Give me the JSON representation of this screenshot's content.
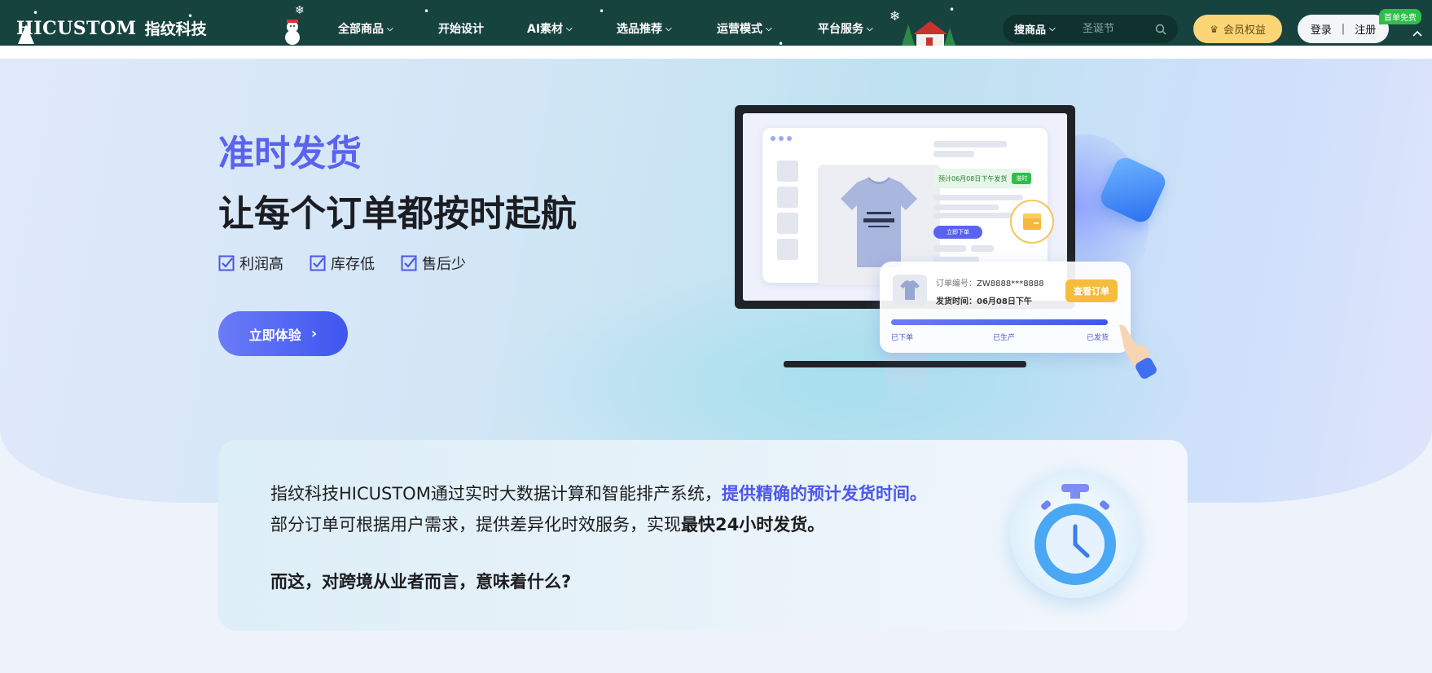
{
  "nav": {
    "logo_en": "HICUSTOM",
    "logo_cn": "指纹科技",
    "menus": [
      {
        "label": "全部商品",
        "has_dropdown": true
      },
      {
        "label": "开始设计",
        "has_dropdown": false
      },
      {
        "label": "AI素材",
        "has_dropdown": true
      },
      {
        "label": "选品推荐",
        "has_dropdown": true
      },
      {
        "label": "运营模式",
        "has_dropdown": true
      },
      {
        "label": "平台服务",
        "has_dropdown": true
      }
    ],
    "search": {
      "category_label": "搜商品",
      "placeholder": "圣诞节"
    },
    "vip_label": "会员权益",
    "login_label": "登录",
    "separator": "|",
    "register_label": "注册",
    "badge": "首单免费"
  },
  "hero": {
    "title_highlight": "准时发货",
    "title_main": "让每个订单都按时起航",
    "features": [
      "利润高",
      "库存低",
      "售后少"
    ],
    "cta_label": "立即体验",
    "cta_arrow": "›"
  },
  "illustration": {
    "eta_text": "预计06月08日下午发货",
    "eta_tag": "准时",
    "order_button": "立即下单",
    "order_no_label": "订单编号：",
    "order_no_value": "ZW8888***8888",
    "ship_time_label": "发货时间：",
    "ship_time_value": "06月08日下午",
    "view_order_label": "查看订单",
    "steps": [
      "已下单",
      "已生产",
      "已发货"
    ],
    "progress": 1.0
  },
  "info": {
    "line1_prefix": "指纹科技HICUSTOM通过实时大数据计算和智能排产系统，",
    "line1_highlight": "提供精确的预计发货时间。",
    "line2_prefix": "部分订单可根据用户需求，提供差异化时效服务，实现",
    "line2_strong": "最快24小时发货。",
    "question": "而这，对跨境从业者而言，意味着什么?"
  },
  "colors": {
    "nav_bg": "#17433f",
    "accent": "#5a63f0",
    "vip_bg": "#fcd676",
    "badge_bg": "#2fbd4b",
    "view_btn": "#f6bd3c"
  }
}
